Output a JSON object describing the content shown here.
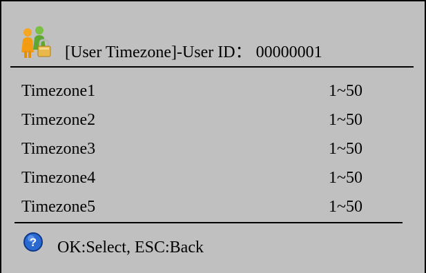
{
  "header": {
    "title": "[User Timezone]-User ID： 00000001",
    "icon": "users-lock-icon"
  },
  "rows": [
    {
      "label": "Timezone1",
      "value": "1~50"
    },
    {
      "label": "Timezone2",
      "value": "1~50"
    },
    {
      "label": "Timezone3",
      "value": "1~50"
    },
    {
      "label": "Timezone4",
      "value": "1~50"
    },
    {
      "label": "Timezone5",
      "value": "1~50"
    }
  ],
  "footer": {
    "hint": "OK:Select, ESC:Back",
    "icon": "help-icon"
  },
  "colors": {
    "background": "#c0c0c0",
    "text": "#000000",
    "help_icon": "#1f5fbf"
  }
}
